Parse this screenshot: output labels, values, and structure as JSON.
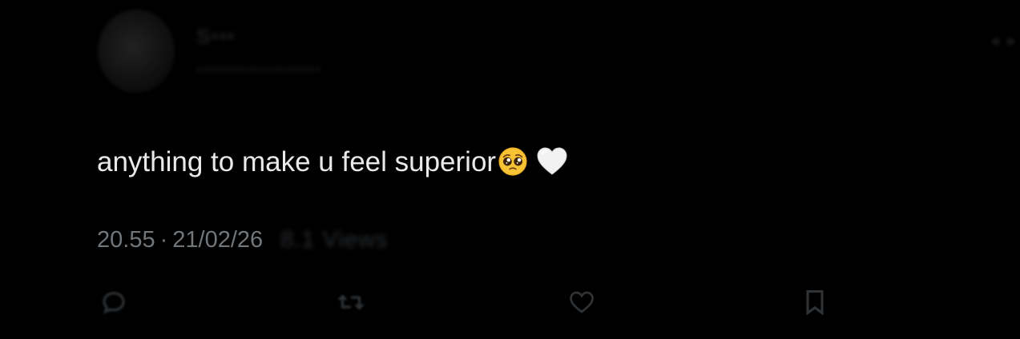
{
  "author": {
    "display_name": "S•••",
    "handle": "••••••••••••••••••"
  },
  "tweet": {
    "text": "anything to make u feel superior",
    "emojis": [
      "pleading-face",
      "white-heart"
    ],
    "time": "20.55",
    "separator": "·",
    "date": "21/02/26",
    "views": "8.1 Views"
  },
  "actions": {
    "icons": [
      "reply-icon",
      "retweet-icon",
      "like-icon",
      "bookmark-icon"
    ]
  },
  "colors": {
    "background": "#000000",
    "text": "#e7e9ea",
    "meta": "#71767b",
    "icon": "#2f3336"
  }
}
